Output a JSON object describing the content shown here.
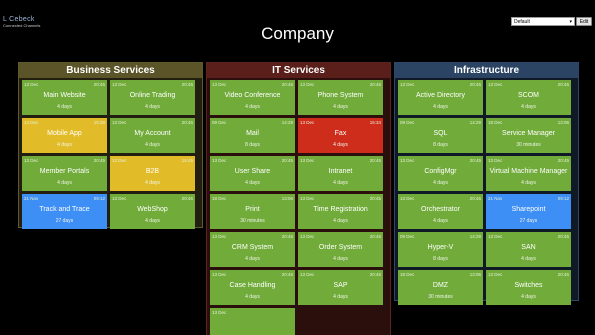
{
  "header": {
    "logo_title": "L  Cebeck",
    "logo_subtitle": "Connected Channels",
    "page_title": "Company",
    "view_select": "Default",
    "edit_label": "Edit"
  },
  "colors": {
    "ok": "#71ab3a",
    "warning": "#e2bc28",
    "critical": "#cf2d1b",
    "info": "#3d8ef5"
  },
  "groups": [
    {
      "title": "Business Services",
      "border_color": "#5f5a2a",
      "header_bg": "#5a5428",
      "body_bg": "#221f10",
      "tiles": [
        {
          "name": "Main Website",
          "date": "13 Dec",
          "time": "20:45",
          "duration": "4 days",
          "status": "ok"
        },
        {
          "name": "Online Trading",
          "date": "13 Dec",
          "time": "20:45",
          "duration": "4 days",
          "status": "ok"
        },
        {
          "name": "Mobile App",
          "date": "14 Dec",
          "time": "15:38",
          "duration": "4 days",
          "status": "warning"
        },
        {
          "name": "My Account",
          "date": "13 Dec",
          "time": "20:45",
          "duration": "4 days",
          "status": "ok"
        },
        {
          "name": "Member Portals",
          "date": "13 Dec",
          "time": "20:45",
          "duration": "4 days",
          "status": "ok"
        },
        {
          "name": "B2B",
          "date": "13 Dec",
          "time": "15:45",
          "duration": "4 days",
          "status": "warning"
        },
        {
          "name": "Track and Trace",
          "date": "21 Nov",
          "time": "09:12",
          "duration": "27 days",
          "status": "info"
        },
        {
          "name": "WebShop",
          "date": "13 Dec",
          "time": "20:45",
          "duration": "4 days",
          "status": "ok"
        }
      ]
    },
    {
      "title": "IT Services",
      "border_color": "#5e2420",
      "header_bg": "#5a1f1a",
      "body_bg": "#2b0f0c",
      "tiles": [
        {
          "name": "Video Conference",
          "date": "13 Dec",
          "time": "20:45",
          "duration": "4 days",
          "status": "ok"
        },
        {
          "name": "Phone System",
          "date": "13 Dec",
          "time": "20:45",
          "duration": "4 days",
          "status": "ok"
        },
        {
          "name": "Mail",
          "date": "09 Dec",
          "time": "14:29",
          "duration": "8 days",
          "status": "ok"
        },
        {
          "name": "Fax",
          "date": "13 Dec",
          "time": "15:34",
          "duration": "4 days",
          "status": "critical"
        },
        {
          "name": "User Share",
          "date": "13 Dec",
          "time": "20:45",
          "duration": "4 days",
          "status": "ok"
        },
        {
          "name": "Intranet",
          "date": "13 Dec",
          "time": "20:45",
          "duration": "4 days",
          "status": "ok"
        },
        {
          "name": "Print",
          "date": "18 Dec",
          "time": "13:06",
          "duration": "30 minutes",
          "status": "ok"
        },
        {
          "name": "Time Registration",
          "date": "13 Dec",
          "time": "20:45",
          "duration": "4 days",
          "status": "ok"
        },
        {
          "name": "CRM System",
          "date": "13 Dec",
          "time": "20:45",
          "duration": "4 days",
          "status": "ok"
        },
        {
          "name": "Order System",
          "date": "13 Dec",
          "time": "20:45",
          "duration": "4 days",
          "status": "ok"
        },
        {
          "name": "Case Handling",
          "date": "13 Dec",
          "time": "20:45",
          "duration": "4 days",
          "status": "ok"
        },
        {
          "name": "SAP",
          "date": "13 Dec",
          "time": "20:45",
          "duration": "4 days",
          "status": "ok"
        },
        {
          "name": "",
          "date": "13 Dec",
          "time": "",
          "duration": "",
          "status": "ok"
        }
      ]
    },
    {
      "title": "Infrastructure",
      "border_color": "#2e4766",
      "header_bg": "#2b4463",
      "body_bg": "#101a27",
      "tiles": [
        {
          "name": "Active Directory",
          "date": "13 Dec",
          "time": "20:45",
          "duration": "4 days",
          "status": "ok"
        },
        {
          "name": "SCOM",
          "date": "13 Dec",
          "time": "20:45",
          "duration": "4 days",
          "status": "ok"
        },
        {
          "name": "SQL",
          "date": "09 Dec",
          "time": "14:29",
          "duration": "8 days",
          "status": "ok"
        },
        {
          "name": "Service Manager",
          "date": "18 Dec",
          "time": "13:06",
          "duration": "30 minutes",
          "status": "ok"
        },
        {
          "name": "ConfigMgr",
          "date": "13 Dec",
          "time": "20:45",
          "duration": "4 days",
          "status": "ok"
        },
        {
          "name": "Virtual Machine Manager",
          "date": "13 Dec",
          "time": "20:45",
          "duration": "4 days",
          "status": "ok"
        },
        {
          "name": "Orchestrator",
          "date": "13 Dec",
          "time": "20:45",
          "duration": "4 days",
          "status": "ok"
        },
        {
          "name": "Sharepoint",
          "date": "21 Nov",
          "time": "09:12",
          "duration": "27 days",
          "status": "info"
        },
        {
          "name": "Hyper-V",
          "date": "09 Dec",
          "time": "14:29",
          "duration": "8 days",
          "status": "ok"
        },
        {
          "name": "SAN",
          "date": "13 Dec",
          "time": "20:45",
          "duration": "4 days",
          "status": "ok"
        },
        {
          "name": "DMZ",
          "date": "18 Dec",
          "time": "13:06",
          "duration": "30 minutes",
          "status": "ok"
        },
        {
          "name": "Switches",
          "date": "13 Dec",
          "time": "20:45",
          "duration": "4 days",
          "status": "ok"
        }
      ]
    }
  ]
}
